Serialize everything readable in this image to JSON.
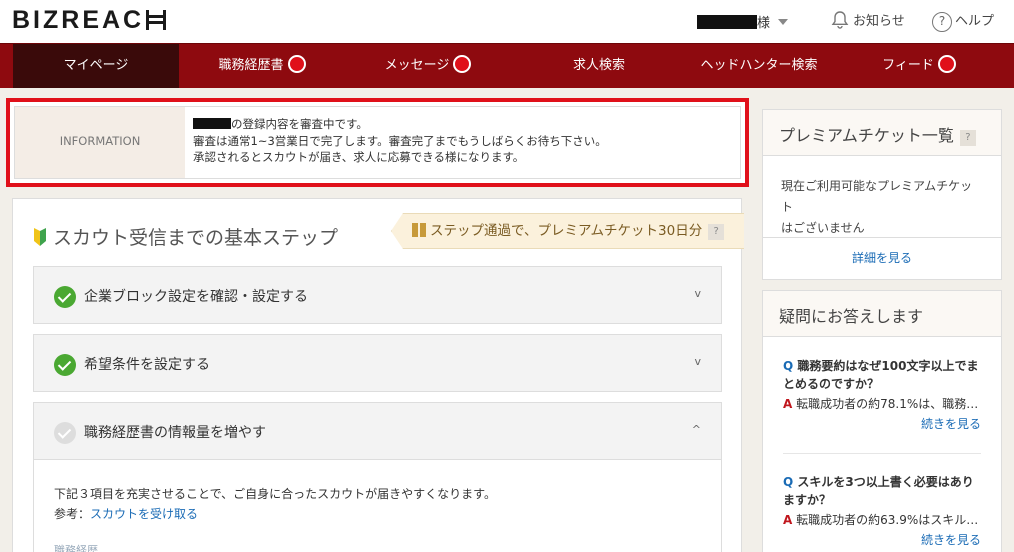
{
  "brand": {
    "logo_main": "BIZREAC",
    "logo_h": "H"
  },
  "header": {
    "user_suffix": "様",
    "notifications": "お知らせ",
    "help": "ヘルプ",
    "help_glyph": "?"
  },
  "nav": {
    "items": [
      {
        "label": "マイページ",
        "active": true
      },
      {
        "label": "職務経歴書",
        "badge": true
      },
      {
        "label": "メッセージ",
        "badge": true
      },
      {
        "label": "求人検索"
      },
      {
        "label": "ヘッドハンター検索"
      },
      {
        "label": "フィード",
        "badge": true
      }
    ]
  },
  "information": {
    "label": "INFORMATION",
    "line1": "の登録内容を審査中です。",
    "line2": "審査は通常1~3営業日で完了します。審査完了までもうしばらくお待ち下さい。",
    "line3": "承認されるとスカウトが届き、求人に応募できる様になります。"
  },
  "steps": {
    "title": "スカウト受信までの基本ステップ",
    "ticket_banner": "ステップ通過で、プレミアムチケット30日分",
    "ticket_help": "?",
    "items": [
      {
        "label": "企業ブロック設定を確認・設定する",
        "done": true,
        "chevron": "v"
      },
      {
        "label": "希望条件を設定する",
        "done": true,
        "chevron": "v"
      },
      {
        "label": "職務経歴書の情報量を増やす",
        "done": false,
        "chevron": "^"
      }
    ],
    "body": {
      "text": "下記３項目を充実させることで、ご自身に合ったスカウトが届きやすくなります。",
      "ref_prefix": "参考：",
      "ref_link": "スカウトを受け取る",
      "cut_text": "職務経歴"
    }
  },
  "premium": {
    "title": "プレミアムチケット一覧",
    "help": "?",
    "body_line1": "現在ご利用可能なプレミアムチケット",
    "body_line2": "はございません",
    "link": "詳細を見る"
  },
  "faq": {
    "title": "疑問にお答えします",
    "items": [
      {
        "q_mark": "Q",
        "question": "職務要約はなぜ100文字以上でまとめるのですか？",
        "a_mark": "A",
        "answer": "転職成功者の約78.1%は、職務…",
        "more": "続きを見る"
      },
      {
        "q_mark": "Q",
        "question": "スキルを3つ以上書く必要はありますか？",
        "a_mark": "A",
        "answer": "転職成功者の約63.9%はスキル…",
        "more": "続きを見る"
      }
    ]
  }
}
